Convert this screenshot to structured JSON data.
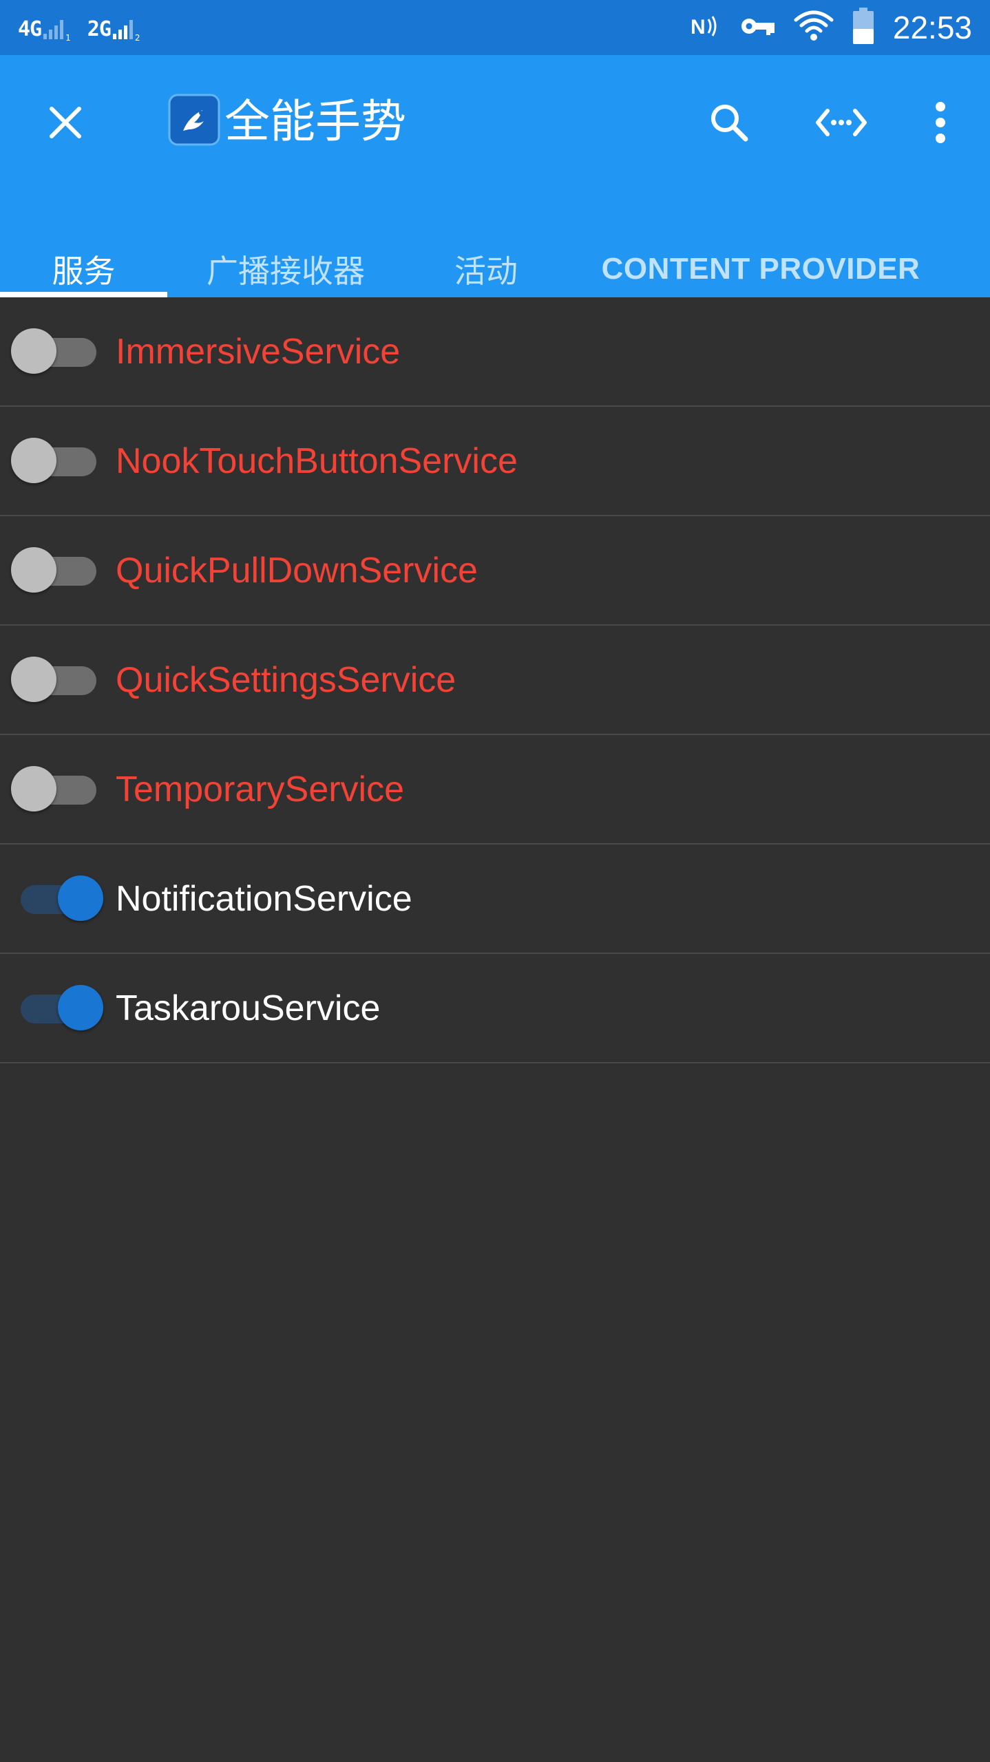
{
  "status_bar": {
    "sim1_label": "4G",
    "sim1_sub": "1",
    "sim2_label": "2G",
    "sim2_sub": "2",
    "time": "22:53",
    "icons": [
      "nfc-icon",
      "vpn-key-icon",
      "wifi-icon",
      "battery-icon"
    ]
  },
  "app_bar": {
    "title": "全能手势",
    "close_icon": "close-icon",
    "actions": [
      "search-icon",
      "code-icon",
      "more-vert-icon"
    ]
  },
  "tabs": [
    {
      "label": "服务",
      "active": true
    },
    {
      "label": "广播接收器",
      "active": false
    },
    {
      "label": "活动",
      "active": false
    },
    {
      "label": "CONTENT PROVIDER",
      "active": false
    }
  ],
  "services": [
    {
      "name": "ImmersiveService",
      "enabled": false
    },
    {
      "name": "NookTouchButtonService",
      "enabled": false
    },
    {
      "name": "QuickPullDownService",
      "enabled": false
    },
    {
      "name": "QuickSettingsService",
      "enabled": false
    },
    {
      "name": "TemporaryService",
      "enabled": false
    },
    {
      "name": "NotificationService",
      "enabled": true
    },
    {
      "name": "TaskarouService",
      "enabled": true
    }
  ],
  "colors": {
    "status_bar": "#1976D2",
    "app_bar": "#2196F3",
    "background": "#303030",
    "disabled_text": "#F44336",
    "enabled_text": "#FFFFFF",
    "switch_on": "#1976D2"
  }
}
